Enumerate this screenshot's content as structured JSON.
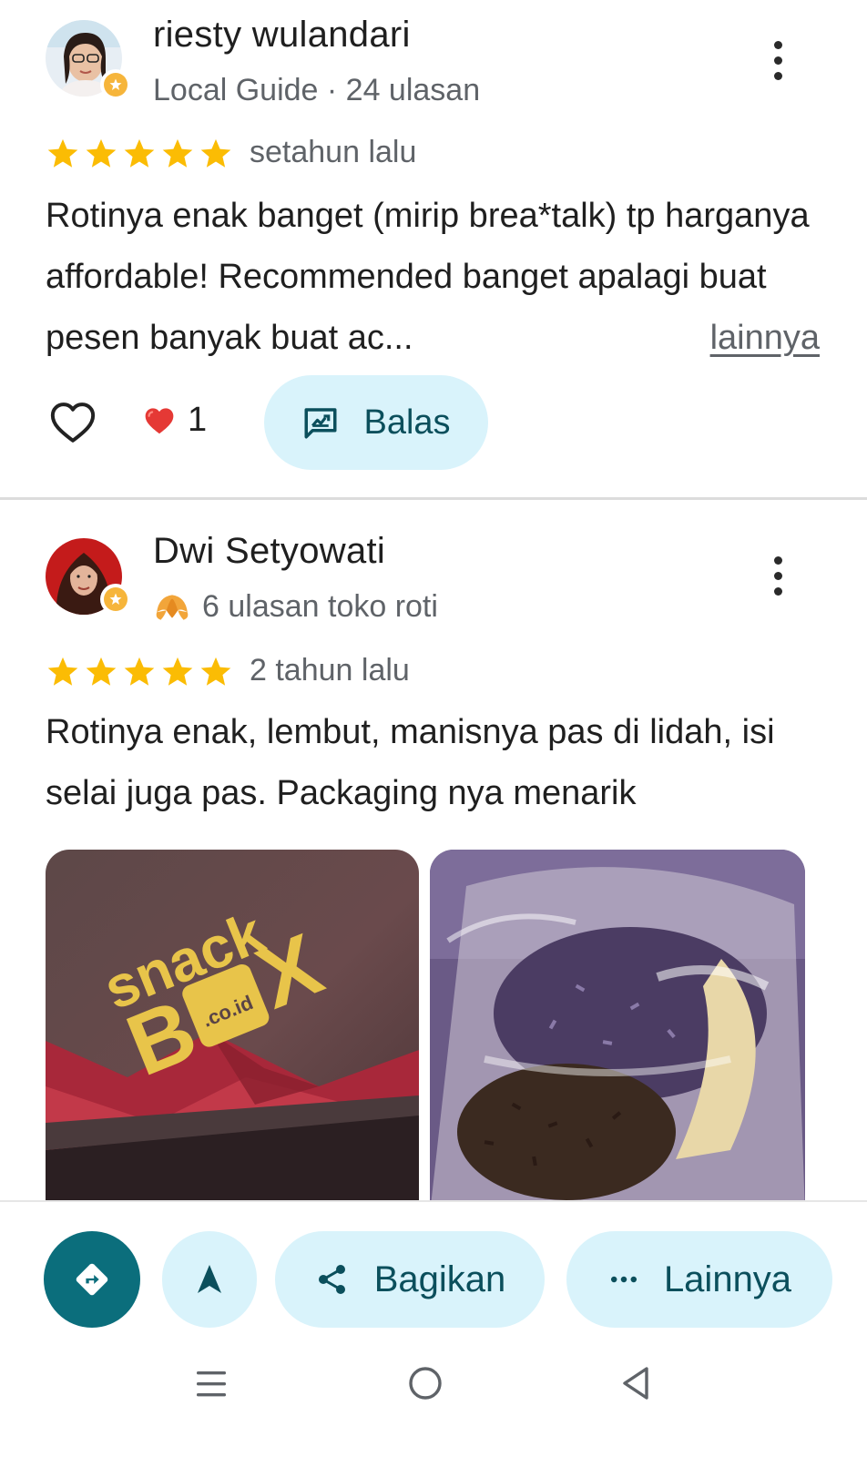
{
  "reviews": [
    {
      "name": "riesty wulandari",
      "meta": "Local Guide · 24 ulasan",
      "rating": 5,
      "when": "setahun lalu",
      "text": "Rotinya enak banget (mirip brea*talk) tp harganya affordable! Recommended banget apalagi buat pesen banyak buat ac...",
      "more_label": "lainnya",
      "likes": "1",
      "reply_label": "Balas"
    },
    {
      "name": "Dwi Setyowati",
      "meta": "6 ulasan toko roti",
      "rating": 5,
      "when": "2 tahun lalu",
      "text": "Rotinya enak, lembut, manisnya pas di lidah, isi selai juga pas. Packaging nya menarik",
      "photo_1_brand": "snack",
      "photo_1_brand_b": "B",
      "photo_1_brand_x": "X",
      "photo_1_brand_domain": ".co.id"
    }
  ],
  "bottom_bar": {
    "share_label": "Bagikan",
    "more_label": "Lainnya"
  },
  "colors": {
    "accent_dark": "#0b6e7c",
    "accent_light": "#d9f3fb",
    "star": "#fbbc04",
    "text_primary": "#1f1f1f",
    "text_secondary": "#5f6368"
  }
}
